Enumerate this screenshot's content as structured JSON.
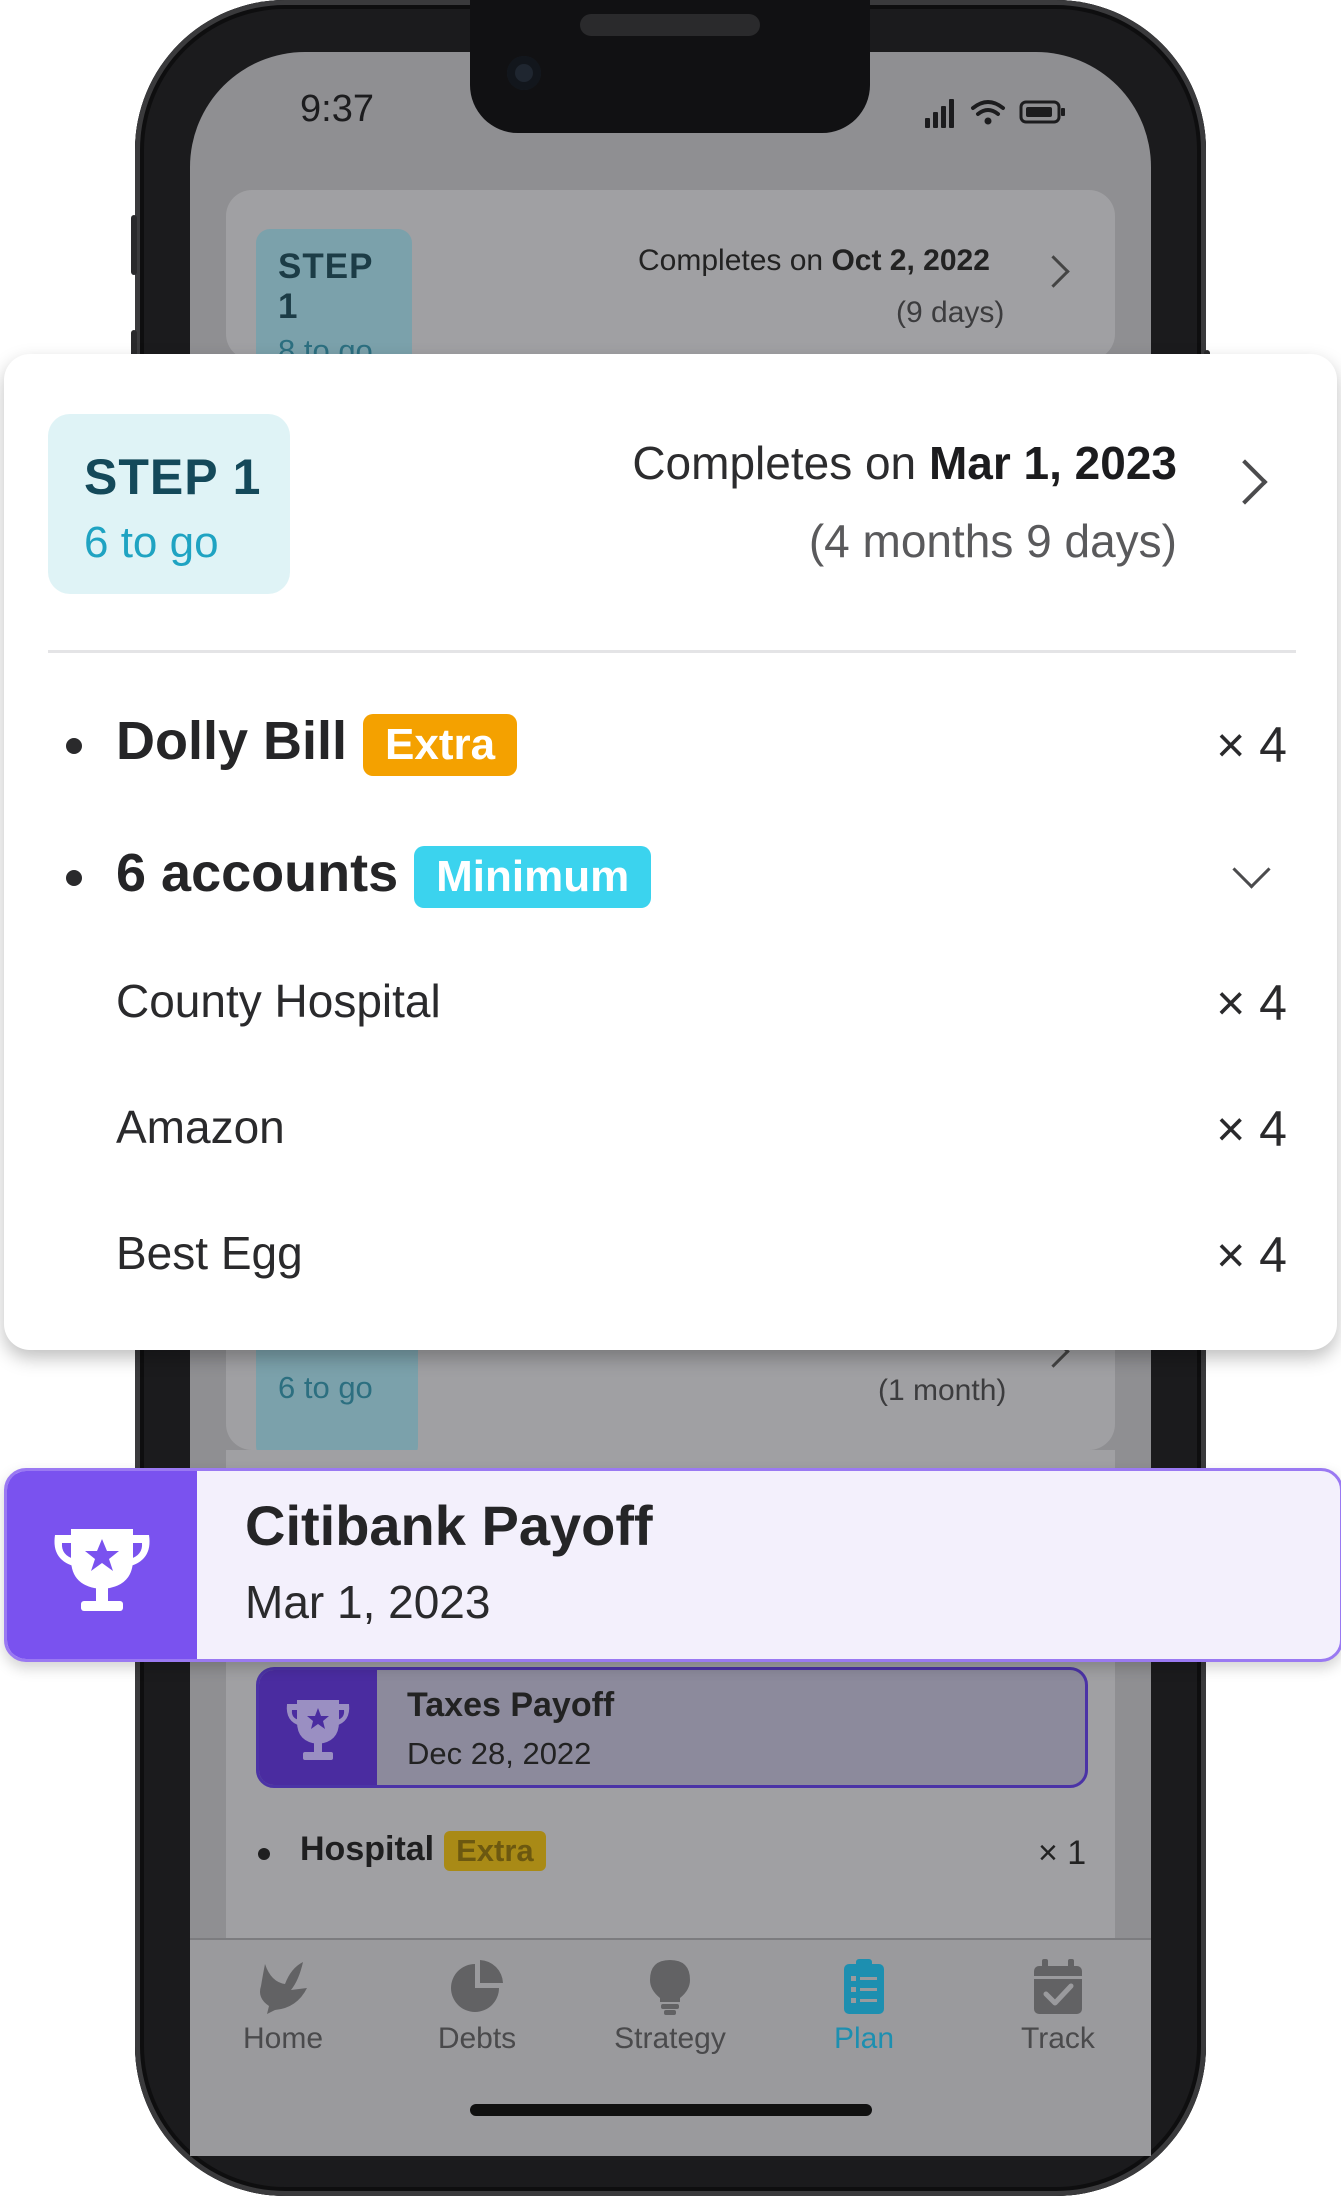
{
  "status_bar": {
    "time": "9:37"
  },
  "background": {
    "step_card": {
      "step_label": "STEP 1",
      "to_go": "8 to go",
      "completes_prefix": "Completes on ",
      "completes_date": "Oct 2, 2022",
      "duration": "(9 days)"
    },
    "step_card_3": {
      "to_go": "6 to go",
      "duration": "(1 month)"
    },
    "milestone": {
      "title": "Taxes Payoff",
      "date": "Dec 28, 2022"
    },
    "rows": [
      {
        "name": "Hospital",
        "badge": "Extra",
        "times": "× 1"
      }
    ]
  },
  "overlay_step": {
    "step_label": "STEP 1",
    "to_go": "6 to go",
    "completes_prefix": "Completes on ",
    "completes_date": "Mar 1, 2023",
    "duration": "(4 months 9 days)",
    "rows": [
      {
        "name": "Dolly Bill",
        "badge": "Extra",
        "times": "× 4"
      },
      {
        "name": "6 accounts",
        "badge": "Minimum"
      }
    ],
    "sub_accounts": [
      {
        "name": "County Hospital",
        "times": "× 4"
      },
      {
        "name": "Amazon",
        "times": "× 4"
      },
      {
        "name": "Best Egg",
        "times": "× 4"
      }
    ],
    "colors": {
      "extra": "#f4a100",
      "minimum": "#3bd3ee",
      "step_bg": "#dff3f6",
      "step_text": "#14495a"
    }
  },
  "overlay_payoff": {
    "title": "Citibank Payoff",
    "date": "Mar 1, 2023",
    "icon": "trophy-icon",
    "accent": "#7a52ef"
  },
  "tabbar": {
    "tabs": [
      {
        "label": "Home",
        "icon": "dove-icon"
      },
      {
        "label": "Debts",
        "icon": "pie-chart-icon"
      },
      {
        "label": "Strategy",
        "icon": "lightbulb-icon"
      },
      {
        "label": "Plan",
        "icon": "clipboard-list-icon",
        "active": true
      },
      {
        "label": "Track",
        "icon": "calendar-check-icon"
      }
    ]
  }
}
